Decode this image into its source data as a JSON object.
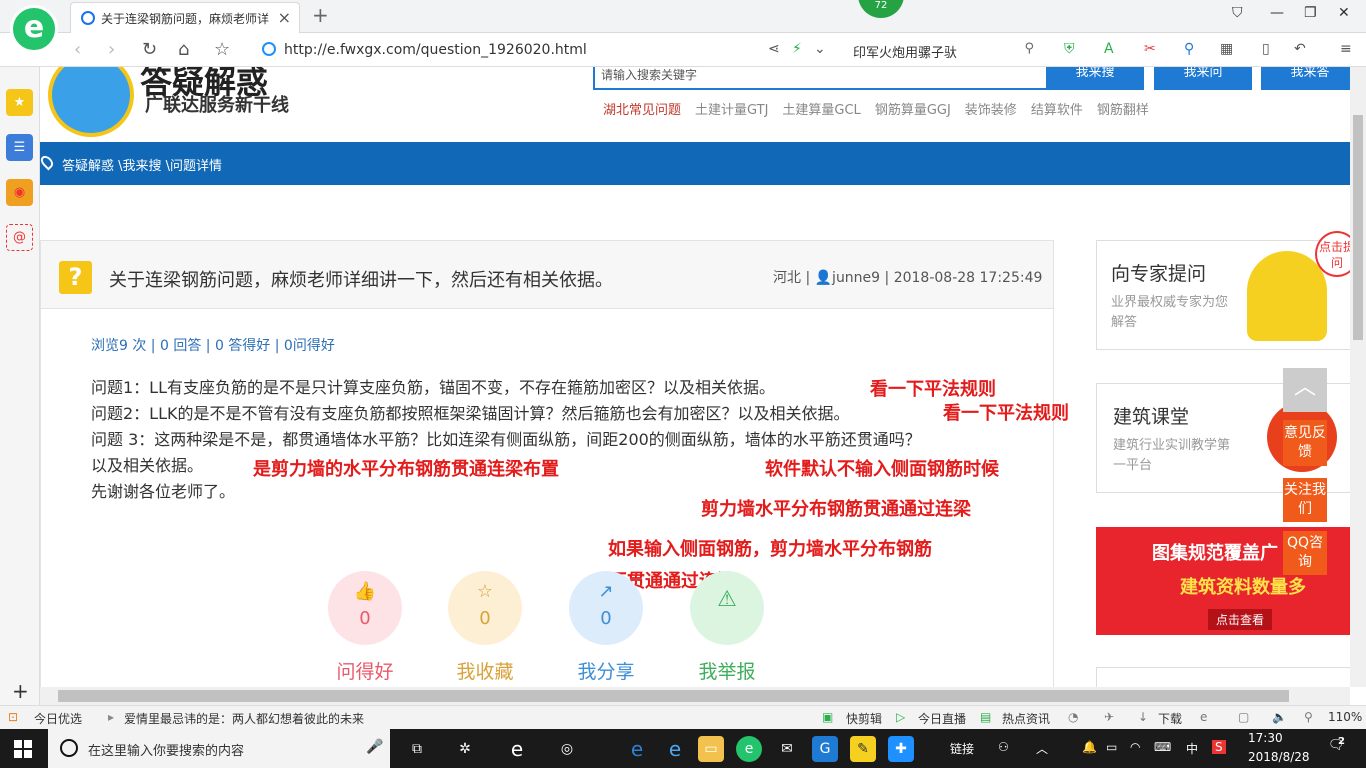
{
  "browser": {
    "logo_letter": "e",
    "tab": {
      "title": "关于连梁钢筋问题，麻烦老师详细讲一下，然后还有相关依据。",
      "close": "×"
    },
    "new_tab": "+",
    "badge_count": "72",
    "url": "http://e.fwxgx.com/question_1926020.html",
    "search_value": "印军火炮用骡子驮"
  },
  "site": {
    "logo_title": "答疑解惑",
    "logo_subtitle": "广联达服务新干线",
    "search_placeholder": "请输入搜索关键字",
    "buttons": [
      "我来搜",
      "我来问",
      "我来答"
    ],
    "topics": [
      "湖北常见问题",
      "土建计量GTJ",
      "土建算量GCL",
      "钢筋算量GGJ",
      "装饰装修",
      "结算软件",
      "钢筋翻样"
    ],
    "breadcrumb": "答疑解惑 \\我来搜 \\问题详情"
  },
  "question": {
    "title": "关于连梁钢筋问题，麻烦老师详细讲一下，然后还有相关依据。",
    "meta": "河北 | 👤junne9 | 2018-08-28 17:25:49",
    "stats": "浏览9 次 | 0 回答 | 0 答得好 | 0问得好",
    "lines": [
      "问题1：LL有支座负筋的是不是只计算支座负筋，锚固不变，不存在箍筋加密区？以及相关依据。",
      "问题2：LLK的是不是不管有没有支座负筋都按照框架梁锚固计算？然后箍筋也会有加密区？以及相关依据。",
      "问题 3：这两种梁是不是，都贯通墙体水平筋？比如连梁有侧面纵筋，间距200的侧面纵筋，墙体的水平筋还贯通吗？",
      "以及相关依据。",
      "先谢谢各位老师了。"
    ]
  },
  "annotations": {
    "a1": "看一下平法规则",
    "a2": "看一下平法规则",
    "a3": "是剪力墙的水平分布钢筋贯通连梁布置",
    "a4": "软件默认不输入侧面钢筋时候",
    "a5": "剪力墙水平分布钢筋贯通通过连梁",
    "a6": "如果输入侧面钢筋，剪力墙水平分布钢筋",
    "a7": "不贯通通过连梁"
  },
  "actions": [
    {
      "label": "问得好",
      "count": "0",
      "color": "#e85a6a",
      "bg": "#fde3e6"
    },
    {
      "label": "我收藏",
      "count": "0",
      "color": "#d9a23a",
      "bg": "#fdefd3"
    },
    {
      "label": "我分享",
      "count": "0",
      "color": "#3d8fd6",
      "bg": "#dcecfb"
    },
    {
      "label": "我举报",
      "count": "",
      "color": "#3fae5c",
      "bg": "#dcf5e1"
    }
  ],
  "sidebar_right": {
    "ask_title": "向专家提问",
    "ask_sub": "业界最权威专家为您解答",
    "ask_tag": "点击提问",
    "class_title": "建筑课堂",
    "class_sub": "建筑行业实训教学第一平台",
    "banner_l1": "图集规范覆盖广",
    "banner_l2": "建筑资料数量多",
    "banner_btn": "点击查看",
    "float_btns": [
      "意见反馈",
      "关注我们",
      "QQ咨询"
    ]
  },
  "statusbar": {
    "left1": "今日优选",
    "news": "爱情里最忌讳的是：两人都幻想着彼此的未来",
    "items": [
      "快剪辑",
      "今日直播",
      "热点资讯",
      "下载"
    ],
    "zoom": "110%"
  },
  "taskbar": {
    "search_placeholder": "在这里输入你要搜索的内容",
    "tray_link": "链接",
    "lang": "中",
    "time": "17:30",
    "date": "2018/8/28",
    "notif": "2"
  }
}
